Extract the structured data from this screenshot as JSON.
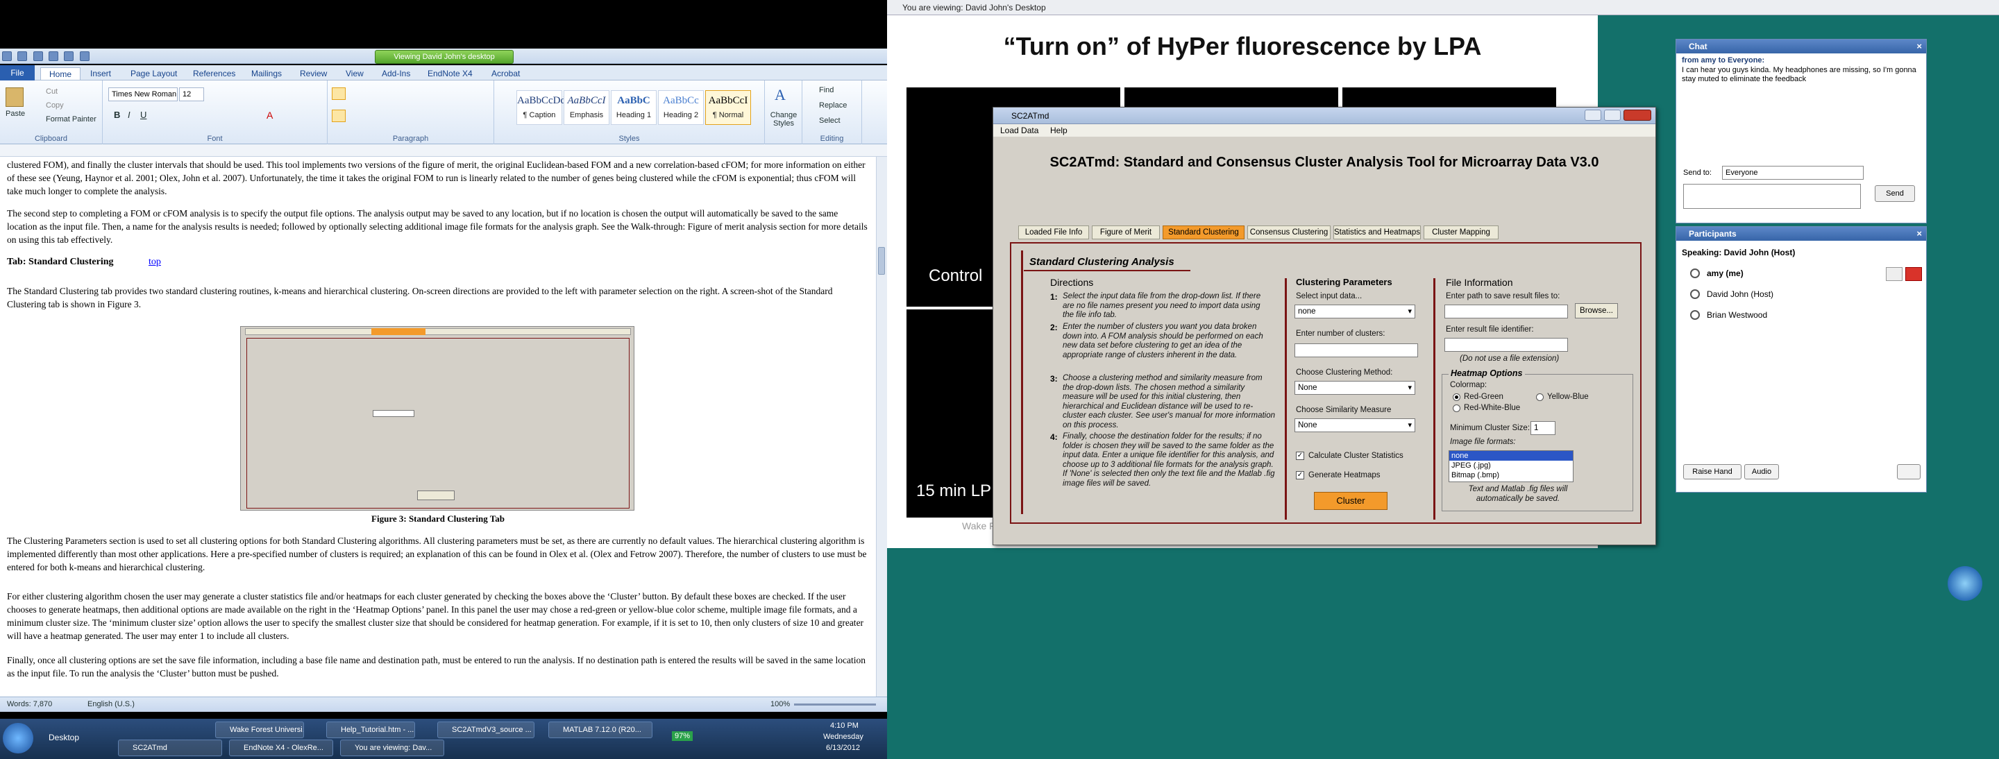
{
  "word": {
    "viewing_badge": "Viewing David John's desktop",
    "tabs": [
      "File",
      "Home",
      "Insert",
      "Page Layout",
      "References",
      "Mailings",
      "Review",
      "View",
      "Add-Ins",
      "EndNote X4",
      "Acrobat"
    ],
    "clipboard": {
      "paste": "Paste",
      "cut": "Cut",
      "copy": "Copy",
      "format_painter": "Format Painter",
      "label": "Clipboard"
    },
    "font": {
      "name": "Times New Roman",
      "size": "12",
      "label": "Font"
    },
    "paragraph_label": "Paragraph",
    "styles": [
      {
        "sample": "AaBbCcDd",
        "name": "¶ Caption"
      },
      {
        "sample": "AaBbCcI",
        "name": "Emphasis"
      },
      {
        "sample": "AaBbC",
        "name": "Heading 1"
      },
      {
        "sample": "AaBbCc",
        "name": "Heading 2"
      },
      {
        "sample": "AaBbCcI",
        "name": "¶ Normal"
      }
    ],
    "styles_label": "Styles",
    "change_styles": "Change Styles",
    "editing": {
      "find": "Find",
      "replace": "Replace",
      "select": "Select",
      "label": "Editing"
    },
    "doc": {
      "p0": "clustered FOM), and finally the cluster intervals that should be used.  This tool implements two versions of the figure of merit, the original Euclidean-based FOM and a new correlation-based cFOM; for more information on either of these see (Yeung, Haynor et al. 2001; Olex, John et al. 2007). Unfortunately, the time it takes the original FOM to run is linearly related to the number of genes being clustered while the cFOM is exponential; thus cFOM will take much longer to complete the analysis.",
      "p1": "The second step to completing a FOM or cFOM analysis is to specify the output file options.  The analysis output may be saved to any location, but if no location is chosen the output will automatically be saved to the same location as the input file.  Then, a name for the analysis results is needed; followed by optionally selecting additional image file formats for the analysis graph.  See the Walk-through: Figure of merit analysis section for more details on using this tab effectively.",
      "heading": "Tab: Standard Clustering",
      "top_link": "top",
      "p2": "The Standard Clustering tab provides two standard clustering routines, k-means and hierarchical clustering. On-screen directions are provided to the left with parameter selection on the right. A screen-shot of the Standard Clustering tab is shown in Figure 3.",
      "figure_caption": "Figure 3: Standard Clustering Tab",
      "p3": "The Clustering Parameters section is used to set all clustering options for both Standard Clustering algorithms. All clustering parameters must be set, as there are currently no default values. The hierarchical clustering algorithm is implemented differently than most other applications. Here a pre-specified number of clusters is required; an explanation of this can be found in Olex et al. (Olex and Fetrow 2007). Therefore, the number of clusters to use must be entered for both k-means and hierarchical clustering.",
      "p4": "For either clustering algorithm chosen the user may generate a cluster statistics file and/or heatmaps for each cluster generated by checking the boxes above the ‘Cluster’ button.  By default these boxes are checked.  If the user chooses to generate heatmaps, then additional options are made available on the right in the ‘Heatmap Options’ panel.  In this panel the user may chose a red-green or yellow-blue color scheme, multiple image file formats, and a minimum cluster size.  The ‘minimum cluster size’ option allows the user to specify the smallest cluster size that should be considered for heatmap generation.  For example, if it is set to 10, then only clusters of size 10 and greater will have a heatmap generated.  The user may enter 1 to include all clusters.",
      "p5": "Finally, once all clustering options are set the save file information, including a base file name and destination path, must be entered to run the analysis.  If no destination path is entered the results will be saved in the same location as the input file.  To run the analysis the ‘Cluster’ button must be pushed."
    },
    "status": {
      "words": "Words: 7,870",
      "lang": "English (U.S.)",
      "zoom": "100%"
    }
  },
  "taskbar": {
    "desktop": "Desktop",
    "items": [
      "Wake Forest Universi...",
      "Help_Tutorial.htm - ...",
      "SC2ATmdV3_source ...",
      "MATLAB 7.12.0 (R20...",
      "SC2ATmd",
      "EndNote X4 - OlexRe...",
      "You are viewing: Dav..."
    ],
    "battery": "97%",
    "time": "4:10 PM",
    "day": "Wednesday",
    "date": "6/13/2012"
  },
  "remote": {
    "title": "You are viewing: David John's Desktop",
    "slide_title": "“Turn on” of HyPer fluorescence by LPA",
    "labels": {
      "control": "Control",
      "lpa": "15 min LP",
      "wake": "Wake F"
    }
  },
  "sc2": {
    "title": "SC2ATmd",
    "menu": [
      "Load Data",
      "Help"
    ],
    "heading": "SC2ATmd:  Standard and Consensus Cluster Analysis Tool for Microarray Data V3.0",
    "tabs": [
      "Loaded File Info",
      "Figure of Merit",
      "Standard Clustering",
      "Consensus Clustering",
      "Statistics and Heatmaps",
      "Cluster Mapping"
    ],
    "panel_title": "Standard Clustering Analysis",
    "directions_title": "Directions",
    "directions": [
      "Select the input data file from the drop-down list. If there are no file names present you need to import data using the file info tab.",
      "Enter the number of clusters you want you data broken down into. A FOM analysis should be performed on each new data set before clustering to get an idea of the appropriate range of clusters inherent in the data.",
      "Choose a clustering method and similarity measure from the drop-down lists. The chosen method a similarity measure will be used for this initial clustering, then hierarchical and Euclidean distance will be used to re-cluster each cluster.  See user's manual for more information on this process.",
      "Finally, choose the destination folder for  the results; if no folder is chosen they will be saved to the same folder as the input data. Enter a unique file identifier for this analysis, and choose up to 3 additional file formats for the analysis graph.  If 'None' is selected then only the text file and the Matlab .fig image files will be saved."
    ],
    "params_title": "Clustering Parameters",
    "select_input": "Select input data...",
    "input_value": "none",
    "num_clusters": "Enter number of clusters:",
    "method_label": "Choose Clustering Method:",
    "method_value": "None",
    "similarity_label": "Choose Similarity Measure",
    "similarity_value": "None",
    "calc_stats": "Calculate Cluster Statistics",
    "gen_heatmaps": "Generate Heatmaps",
    "cluster_btn": "Cluster",
    "file_title": "File Information",
    "path_label": "Enter path to save result files to:",
    "browse": "Browse...",
    "identifier_label": "Enter result file identifier:",
    "no_ext": "(Do not use a file extension)",
    "heatmap_title": "Heatmap Options",
    "colormap": "Colormap:",
    "red_green": "Red-Green",
    "yellow_blue": "Yellow-Blue",
    "red_white_blue": "Red-White-Blue",
    "min_cluster": "Minimum Cluster Size:",
    "min_value": "1",
    "image_formats": "Image file formats:",
    "formats": [
      "none",
      "JPEG (.jpg)",
      "Bitmap (.bmp)"
    ],
    "note": "Text and Matlab .fig files will automatically be saved."
  },
  "chat": {
    "title": "Chat",
    "from": "from amy to Everyone:",
    "message": "I can hear you guys kinda.  My headphones are missing, so I'm gonna stay muted to eliminate the feedback",
    "send_to": "Send to:",
    "send_to_value": "Everyone",
    "send": "Send"
  },
  "participants": {
    "title": "Participants",
    "speaking": "Speaking: David John (Host)",
    "list": [
      "amy (me)",
      "David John (Host)",
      "Brian Westwood"
    ],
    "raise_hand": "Raise Hand",
    "audio": "Audio"
  },
  "colors": {
    "accent": "#f39a2b",
    "panel_border": "#7a1414",
    "teal": "#13706a"
  }
}
